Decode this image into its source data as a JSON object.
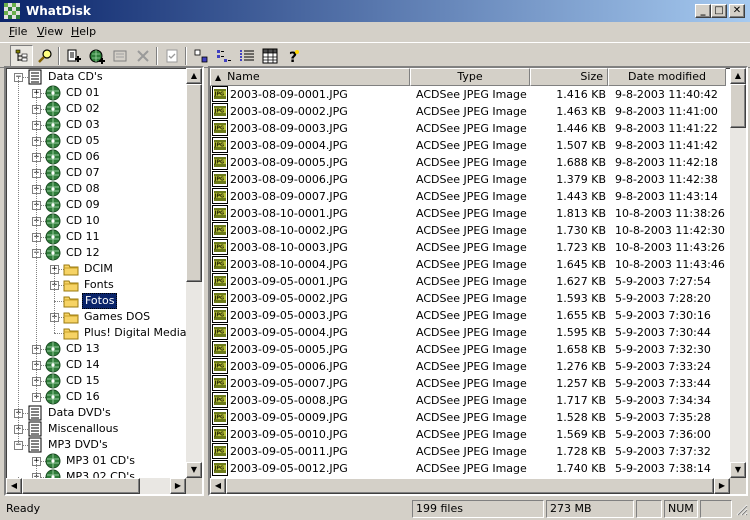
{
  "window": {
    "title": "WhatDisk",
    "minimize_glyph": "_",
    "maximize_glyph": "□",
    "close_glyph": "✕"
  },
  "menu": [
    {
      "label": "File",
      "accel": "F",
      "rest": "ile"
    },
    {
      "label": "View",
      "accel": "V",
      "rest": "iew"
    },
    {
      "label": "Help",
      "accel": "H",
      "rest": "elp"
    }
  ],
  "toolbar": {
    "icons": [
      "tree-view-icon",
      "find-icon",
      "add-disk-icon",
      "add-network-icon",
      "disk-properties-icon",
      "delete-icon",
      "properties-icon",
      "large-icons-icon",
      "list-icon",
      "details-icon",
      "grid-icon",
      "help-icon"
    ]
  },
  "tree": {
    "items": [
      {
        "label": "Data CD's",
        "level": 0,
        "type": "group",
        "expander": "−"
      },
      {
        "label": "CD 01",
        "level": 1,
        "type": "disc",
        "expander": "+"
      },
      {
        "label": "CD 02",
        "level": 1,
        "type": "disc",
        "expander": "+"
      },
      {
        "label": "CD 03",
        "level": 1,
        "type": "disc",
        "expander": "+"
      },
      {
        "label": "CD 05",
        "level": 1,
        "type": "disc",
        "expander": "+"
      },
      {
        "label": "CD 06",
        "level": 1,
        "type": "disc",
        "expander": "+"
      },
      {
        "label": "CD 07",
        "level": 1,
        "type": "disc",
        "expander": "+"
      },
      {
        "label": "CD 08",
        "level": 1,
        "type": "disc",
        "expander": "+"
      },
      {
        "label": "CD 09",
        "level": 1,
        "type": "disc",
        "expander": "+"
      },
      {
        "label": "CD 10",
        "level": 1,
        "type": "disc",
        "expander": "+"
      },
      {
        "label": "CD 11",
        "level": 1,
        "type": "disc",
        "expander": "+"
      },
      {
        "label": "CD 12",
        "level": 1,
        "type": "disc",
        "expander": "−"
      },
      {
        "label": "DCIM",
        "level": 2,
        "type": "folder",
        "expander": "+"
      },
      {
        "label": "Fonts",
        "level": 2,
        "type": "folder",
        "expander": "+"
      },
      {
        "label": "Fotos",
        "level": 2,
        "type": "folder",
        "expander": "",
        "selected": true
      },
      {
        "label": "Games DOS",
        "level": 2,
        "type": "folder",
        "expander": "+"
      },
      {
        "label": "Plus! Digital Media Edition",
        "level": 2,
        "type": "folder",
        "expander": ""
      },
      {
        "label": "CD 13",
        "level": 1,
        "type": "disc",
        "expander": "+"
      },
      {
        "label": "CD 14",
        "level": 1,
        "type": "disc",
        "expander": "+"
      },
      {
        "label": "CD 15",
        "level": 1,
        "type": "disc",
        "expander": "+"
      },
      {
        "label": "CD 16",
        "level": 1,
        "type": "disc",
        "expander": "+"
      },
      {
        "label": "Data DVD's",
        "level": 0,
        "type": "group",
        "expander": "+"
      },
      {
        "label": "Miscenallous",
        "level": 0,
        "type": "group",
        "expander": "+"
      },
      {
        "label": "MP3 DVD's",
        "level": 0,
        "type": "group",
        "expander": "−"
      },
      {
        "label": "MP3 01 CD's",
        "level": 1,
        "type": "disc",
        "expander": "+"
      },
      {
        "label": "MP3 02 CD's",
        "level": 1,
        "type": "disc",
        "expander": "+"
      }
    ]
  },
  "list": {
    "columns": [
      "Name",
      "Type",
      "Size",
      "Date modified"
    ],
    "rows": [
      [
        "2003-08-09-0001.JPG",
        "ACDSee JPEG Image",
        "1.416 KB",
        "9-8-2003 11:40:42"
      ],
      [
        "2003-08-09-0002.JPG",
        "ACDSee JPEG Image",
        "1.463 KB",
        "9-8-2003 11:41:00"
      ],
      [
        "2003-08-09-0003.JPG",
        "ACDSee JPEG Image",
        "1.446 KB",
        "9-8-2003 11:41:22"
      ],
      [
        "2003-08-09-0004.JPG",
        "ACDSee JPEG Image",
        "1.507 KB",
        "9-8-2003 11:41:42"
      ],
      [
        "2003-08-09-0005.JPG",
        "ACDSee JPEG Image",
        "1.688 KB",
        "9-8-2003 11:42:18"
      ],
      [
        "2003-08-09-0006.JPG",
        "ACDSee JPEG Image",
        "1.379 KB",
        "9-8-2003 11:42:38"
      ],
      [
        "2003-08-09-0007.JPG",
        "ACDSee JPEG Image",
        "1.443 KB",
        "9-8-2003 11:43:14"
      ],
      [
        "2003-08-10-0001.JPG",
        "ACDSee JPEG Image",
        "1.813 KB",
        "10-8-2003 11:38:26"
      ],
      [
        "2003-08-10-0002.JPG",
        "ACDSee JPEG Image",
        "1.730 KB",
        "10-8-2003 11:42:30"
      ],
      [
        "2003-08-10-0003.JPG",
        "ACDSee JPEG Image",
        "1.723 KB",
        "10-8-2003 11:43:26"
      ],
      [
        "2003-08-10-0004.JPG",
        "ACDSee JPEG Image",
        "1.645 KB",
        "10-8-2003 11:43:46"
      ],
      [
        "2003-09-05-0001.JPG",
        "ACDSee JPEG Image",
        "1.627 KB",
        "5-9-2003 7:27:54"
      ],
      [
        "2003-09-05-0002.JPG",
        "ACDSee JPEG Image",
        "1.593 KB",
        "5-9-2003 7:28:20"
      ],
      [
        "2003-09-05-0003.JPG",
        "ACDSee JPEG Image",
        "1.655 KB",
        "5-9-2003 7:30:16"
      ],
      [
        "2003-09-05-0004.JPG",
        "ACDSee JPEG Image",
        "1.595 KB",
        "5-9-2003 7:30:44"
      ],
      [
        "2003-09-05-0005.JPG",
        "ACDSee JPEG Image",
        "1.658 KB",
        "5-9-2003 7:32:30"
      ],
      [
        "2003-09-05-0006.JPG",
        "ACDSee JPEG Image",
        "1.276 KB",
        "5-9-2003 7:33:24"
      ],
      [
        "2003-09-05-0007.JPG",
        "ACDSee JPEG Image",
        "1.257 KB",
        "5-9-2003 7:33:44"
      ],
      [
        "2003-09-05-0008.JPG",
        "ACDSee JPEG Image",
        "1.717 KB",
        "5-9-2003 7:34:34"
      ],
      [
        "2003-09-05-0009.JPG",
        "ACDSee JPEG Image",
        "1.528 KB",
        "5-9-2003 7:35:28"
      ],
      [
        "2003-09-05-0010.JPG",
        "ACDSee JPEG Image",
        "1.569 KB",
        "5-9-2003 7:36:00"
      ],
      [
        "2003-09-05-0011.JPG",
        "ACDSee JPEG Image",
        "1.728 KB",
        "5-9-2003 7:37:32"
      ],
      [
        "2003-09-05-0012.JPG",
        "ACDSee JPEG Image",
        "1.740 KB",
        "5-9-2003 7:38:14"
      ]
    ]
  },
  "status": {
    "text": "Ready",
    "file_count": "199 files",
    "total_size": "273 MB",
    "num_lock": "NUM"
  },
  "colors": {
    "title_active": "#0a246a",
    "selection": "#0a246a",
    "face": "#d4d0c8"
  }
}
